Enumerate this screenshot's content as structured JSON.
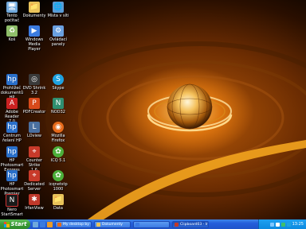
{
  "desktop": {
    "icons": [
      {
        "label": "Tento počítač",
        "icon": "my-computer-icon",
        "color": "#6fa8dc"
      },
      {
        "label": "Dokumenty",
        "icon": "folder-icon",
        "color": "#e8c25a"
      },
      {
        "label": "Místa v síti",
        "icon": "network-places-icon",
        "color": "#5b9bd5"
      },
      {
        "label": "Koš",
        "icon": "recycle-bin-icon",
        "color": "#8fbf6a"
      },
      {
        "label": "Windows Media\nPlayer",
        "icon": "media-player-icon",
        "color": "#3b7be0"
      },
      {
        "label": "Ovládací\npanely",
        "icon": "control-panel-icon",
        "color": "#6aa0e0"
      },
      {
        "label": "Prohlížeč\ndokumentů HP",
        "icon": "hp-document-viewer-icon",
        "color": "#2a6fc9"
      },
      {
        "label": "DVD Shrink 3.2",
        "icon": "dvd-shrink-icon",
        "color": "#3a3a3a"
      },
      {
        "label": "Skype",
        "icon": "skype-icon",
        "color": "#1fa2e0"
      },
      {
        "label": "Adobe Reader\n7.0",
        "icon": "adobe-reader-icon",
        "color": "#cc2222"
      },
      {
        "label": "PDFCreator",
        "icon": "pdfcreator-icon",
        "color": "#d84a1b"
      },
      {
        "label": "NOD32",
        "icon": "nod32-icon",
        "color": "#2f8f6f"
      },
      {
        "label": "Centrum\nřešení HP",
        "icon": "hp-solution-center-icon",
        "color": "#2a6fc9"
      },
      {
        "label": "LOview",
        "icon": "loview-icon",
        "color": "#4a6fa0"
      },
      {
        "label": "Mozilla Firefox",
        "icon": "firefox-icon",
        "color": "#e66a1a"
      },
      {
        "label": "HP Photosmart\nExpress",
        "icon": "hp-photosmart-express-icon",
        "color": "#2a6fc9"
      },
      {
        "label": "Counter Strike\n1.6",
        "icon": "counter-strike-icon",
        "color": "#c83a2a"
      },
      {
        "label": "ICQ 5.1",
        "icon": "icq-icon",
        "color": "#4caf3a"
      },
      {
        "label": "HP Photosmart\nPremier",
        "icon": "hp-photosmart-premier-icon",
        "color": "#2a6fc9"
      },
      {
        "label": "Dedicated\nServer",
        "icon": "dedicated-server-icon",
        "color": "#c83a2a"
      },
      {
        "label": "icqnetstp 1000",
        "icon": "icq-setup-icon",
        "color": "#4caf3a"
      },
      {
        "label": "Nero\nStartSmart",
        "icon": "nero-icon",
        "color": "#1a1a1a"
      },
      {
        "label": "IrfanView",
        "icon": "irfanview-icon",
        "color": "#c0392b"
      },
      {
        "label": "Data",
        "icon": "data-folder-icon",
        "color": "#e8c25a"
      }
    ]
  },
  "taskbar": {
    "start_label": "Start",
    "quick_launch": [
      {
        "icon": "show-desktop-icon",
        "color": "#6fa8dc"
      },
      {
        "icon": "internet-explorer-icon",
        "color": "#3b7be0"
      },
      {
        "icon": "media-player-quick-icon",
        "color": "#e89a2a"
      }
    ],
    "tasks": [
      {
        "label": "My desktop by ~Fazz...",
        "icon": "browser-task-icon",
        "color": "#e66a1a",
        "active": false
      },
      {
        "label": "Dokumenty",
        "icon": "folder-task-icon",
        "color": "#e8c25a",
        "active": false
      },
      {
        "label": "",
        "icon": "blank-task-icon",
        "color": "#3b7ae4",
        "active": false
      },
      {
        "label": "Clipboard03 - IrfanView",
        "icon": "irfanview-task-icon",
        "color": "#c0392b",
        "active": true
      }
    ],
    "tray_icons": [
      {
        "icon": "network-tray-icon",
        "color": "#7fc7ff"
      },
      {
        "icon": "volume-tray-icon",
        "color": "#ffffff"
      },
      {
        "icon": "antivirus-tray-icon",
        "color": "#3fbf6a"
      },
      {
        "icon": "skype-tray-icon",
        "color": "#1fa2e0"
      }
    ],
    "clock": "13:25"
  }
}
